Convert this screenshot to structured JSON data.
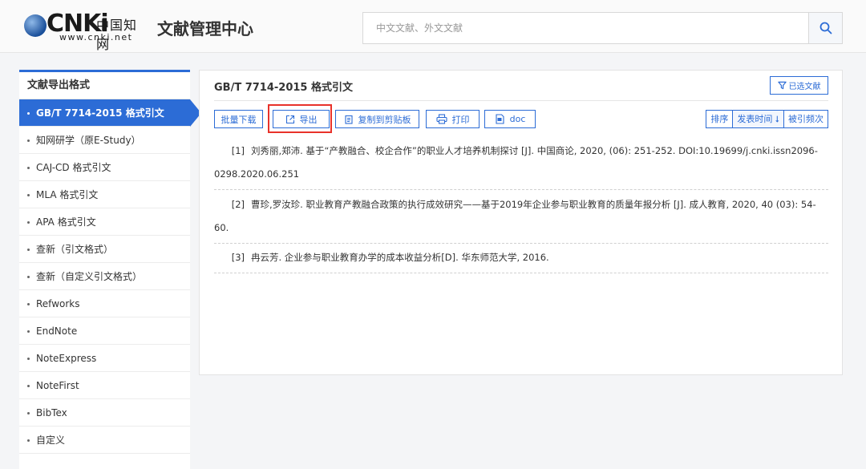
{
  "header": {
    "logo_brand": "CNKi",
    "logo_cn": "中国知网",
    "logo_url": "www.cnki.net",
    "title": "文献管理中心",
    "search_placeholder": "中文文献、外文文献"
  },
  "sidebar": {
    "title": "文献导出格式",
    "items": [
      {
        "label": "GB/T 7714-2015 格式引文",
        "active": true
      },
      {
        "label": "知网研学（原E-Study）"
      },
      {
        "label": "CAJ-CD 格式引文"
      },
      {
        "label": "MLA 格式引文"
      },
      {
        "label": "APA 格式引文"
      },
      {
        "label": "查新（引文格式）"
      },
      {
        "label": "查新（自定义引文格式）"
      },
      {
        "label": "Refworks"
      },
      {
        "label": "EndNote"
      },
      {
        "label": "NoteExpress"
      },
      {
        "label": "NoteFirst"
      },
      {
        "label": "BibTex"
      },
      {
        "label": "自定义"
      }
    ]
  },
  "main": {
    "title": "GB/T 7714-2015 格式引文",
    "selected_label": "已选文献",
    "toolbar": {
      "batch_download": "批量下载",
      "export": "导出",
      "copy": "复制到剪贴板",
      "print": "打印",
      "doc": "doc"
    },
    "sort": {
      "label": "排序",
      "by_date": "发表时间",
      "by_citations": "被引频次"
    },
    "references": [
      {
        "idx": "[1]",
        "text": "刘秀丽,郑沛. 基于“产教融合、校企合作”的职业人才培养机制探讨 [J]. 中国商论, 2020, (06): 251-252. DOI:10.19699/j.cnki.issn2096-0298.2020.06.251"
      },
      {
        "idx": "[2]",
        "text": "曹珍,罗汝珍. 职业教育产教融合政策的执行成效研究——基于2019年企业参与职业教育的质量年报分析 [J]. 成人教育, 2020, 40 (03): 54-60."
      },
      {
        "idx": "[3]",
        "text": "冉云芳. 企业参与职业教育办学的成本收益分析[D]. 华东师范大学, 2016."
      }
    ]
  },
  "colors": {
    "accent": "#2c6cd6",
    "highlight": "#e8322a"
  }
}
